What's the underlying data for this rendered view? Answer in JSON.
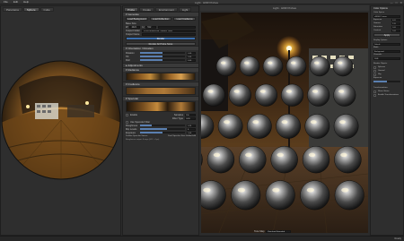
{
  "menu": {
    "items": [
      "File",
      "Edit",
      "Help"
    ]
  },
  "window": {
    "title": "Light · HDR Probes",
    "controls": [
      "—",
      "□",
      "✕"
    ]
  },
  "left_panel": {
    "tabs": [
      "Panorama",
      "Sphere",
      "Cube"
    ]
  },
  "middle_panel": {
    "tabs": [
      "Probe",
      "Create",
      "Environment",
      "Light"
    ],
    "sections": {
      "generate": {
        "title": "Generate",
        "preset_buttons": [
          "Load Background",
          "Load Reflection",
          "Load Irradiance"
        ],
        "size_label": "Base Size",
        "width_label": "W",
        "width_value": "1024",
        "height_label": "H",
        "height_value": "512",
        "output_label": "Output Folder",
        "output_value": "/Users/probes/hdr_outdoor_night",
        "name_label": "Output Name",
        "render_button": "Render",
        "render_all_button": "Render All Probe Sizes"
      },
      "orientation": {
        "title": "Orientation / Rotation",
        "rows": [
          {
            "label": "Rotation",
            "value": "0.00",
            "level": 0.5
          },
          {
            "label": "Tilt",
            "value": "0.00",
            "level": 0.5
          },
          {
            "label": "Roll",
            "value": "0.00",
            "level": 0.5
          }
        ]
      },
      "adjustments": {
        "title": "Adjustments"
      },
      "radiance": {
        "title": "Radiance"
      },
      "irradiance": {
        "title": "Irradiance"
      },
      "specular": {
        "title": "Specular",
        "enable_label": "Enable",
        "samples_label": "Samples",
        "samples_value": "256",
        "filter_label": "Filter Type",
        "filter_value": "GGX",
        "use_specular_label": "Use Specular Filter",
        "roughness_label": "Roughness",
        "roughness_value": "0.25",
        "mip_label": "Mip Levels",
        "mip_value": "8",
        "exposure_label": "Exposure",
        "exposure_value": "0.00",
        "footer_left": "Prefilter Specular Source",
        "footer_right": "Final Specular Size: 4096x2048",
        "status_note": "Roughness output: 8 mips (512 - 4 px)"
      }
    }
  },
  "viewport": {
    "label": "Light · HDR Probes",
    "bottom_label": "Tone Map",
    "bottom_value": "Reinhard Extended",
    "grid_rows": 5,
    "grid_cols": 6
  },
  "right_panel": {
    "title": "Color Options",
    "groups": [
      {
        "label": "Color Space",
        "value": "sRGB / Linear"
      },
      {
        "label": "Exposure",
        "value": "0.00"
      },
      {
        "label": "Gamma",
        "value": "2.20"
      },
      {
        "label": "Saturation",
        "value": "1.00"
      },
      {
        "label": "Contrast",
        "value": "1.00"
      }
    ],
    "apply_button": "Apply",
    "sections": [
      {
        "label": "Display Options",
        "value": "Default"
      },
      {
        "label": "Mode",
        "value": "Background"
      },
      {
        "label": "Channels",
        "value": "RGB"
      }
    ],
    "render_label": "Render Objects",
    "render_items": [
      "Spheres",
      "Ground",
      "Sky"
    ],
    "exposure_label": "Exposure",
    "transformations_label": "Transformations",
    "show_gizmo_label": "Show Gizmo",
    "enable_label": "Enable Transformations"
  },
  "statusbar": {
    "right_text": "Ready"
  },
  "colors": {
    "accent": "#3b6fae",
    "panel": "#2e2e2e",
    "bg": "#2b2b2b"
  }
}
